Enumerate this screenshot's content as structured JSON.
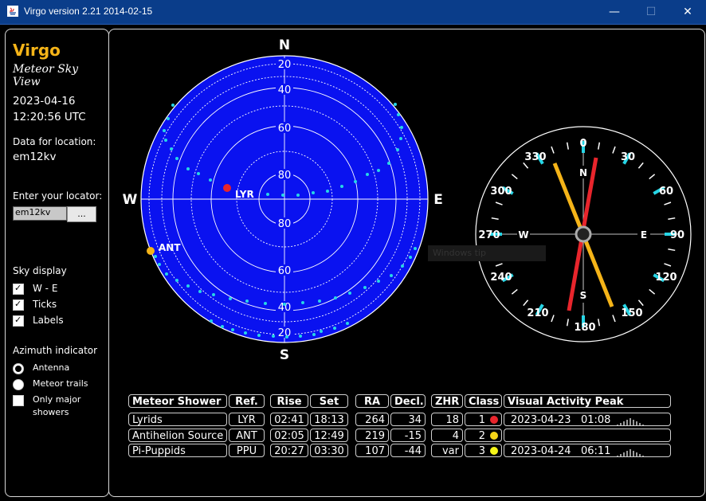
{
  "window": {
    "title": "Virgo version 2.21 2014-02-15",
    "min": "—",
    "max": "☐",
    "close": "✕"
  },
  "sidebar": {
    "app_name": "Virgo",
    "app_subtitle": "Meteor Sky View",
    "date": "2023-04-16",
    "time": "12:20:56 UTC",
    "location_label": "Data for location:",
    "location": "em12kv",
    "locator_label": "Enter your locator:",
    "locator_value": "em12kv",
    "locator_button": "...",
    "sky_display_label": "Sky display",
    "sky_options": [
      {
        "label": "W - E",
        "checked": true
      },
      {
        "label": "Ticks",
        "checked": true
      },
      {
        "label": "Labels",
        "checked": true
      }
    ],
    "azimuth_label": "Azimuth indicator",
    "azimuth_options": [
      {
        "label": "Antenna",
        "selected": true
      },
      {
        "label": "Meteor trails",
        "selected": false
      },
      {
        "label": "Only major",
        "label2": "showers",
        "selected": false
      }
    ]
  },
  "sky": {
    "north": "N",
    "south": "S",
    "west": "W",
    "east": "E",
    "elevations_top": [
      "20",
      "40",
      "60",
      "80"
    ],
    "elevations_bottom": [
      "80",
      "60",
      "40",
      "20"
    ],
    "shower_labels": [
      {
        "code": "LYR",
        "color": "#e8252c"
      },
      {
        "code": "ANT",
        "color": "#f5b418"
      }
    ],
    "colors": {
      "sky": "#0a12f0",
      "dots": "#27d6e6"
    }
  },
  "compass": {
    "labels": [
      "0",
      "30",
      "60",
      "90",
      "120",
      "150",
      "180",
      "210",
      "240",
      "270",
      "300",
      "330"
    ],
    "cardinals": {
      "n": "N",
      "s": "S",
      "w": "W",
      "e": "E"
    },
    "needle_colors": {
      "red": "#e8252c",
      "yellow": "#f5b418"
    },
    "tooltip": "Windows tip"
  },
  "table": {
    "headers": {
      "shower": "Meteor Shower",
      "ref": "Ref.",
      "rise": "Rise",
      "set": "Set",
      "ra": "RA",
      "decl": "Decl.",
      "zhr": "ZHR",
      "class": "Class",
      "peak": "Visual Activity Peak"
    },
    "rows": [
      {
        "shower": "Lyrids",
        "ref": "LYR",
        "rise": "02:41",
        "set": "18:13",
        "ra": "264",
        "decl": "34",
        "zhr": "18",
        "class": "1",
        "color": "#e8252c",
        "peak_date": "2023-04-23",
        "peak_time": "01:08"
      },
      {
        "shower": "Antihelion Source",
        "ref": "ANT",
        "rise": "02:05",
        "set": "12:49",
        "ra": "219",
        "decl": "-15",
        "zhr": "4",
        "class": "2",
        "color": "#f5d418",
        "peak_date": "",
        "peak_time": ""
      },
      {
        "shower": "Pi-Puppids",
        "ref": "PPU",
        "rise": "20:27",
        "set": "03:30",
        "ra": "107",
        "decl": "-44",
        "zhr": "var",
        "class": "3",
        "color": "#f5f518",
        "peak_date": "2023-04-24",
        "peak_time": "06:11"
      }
    ]
  }
}
